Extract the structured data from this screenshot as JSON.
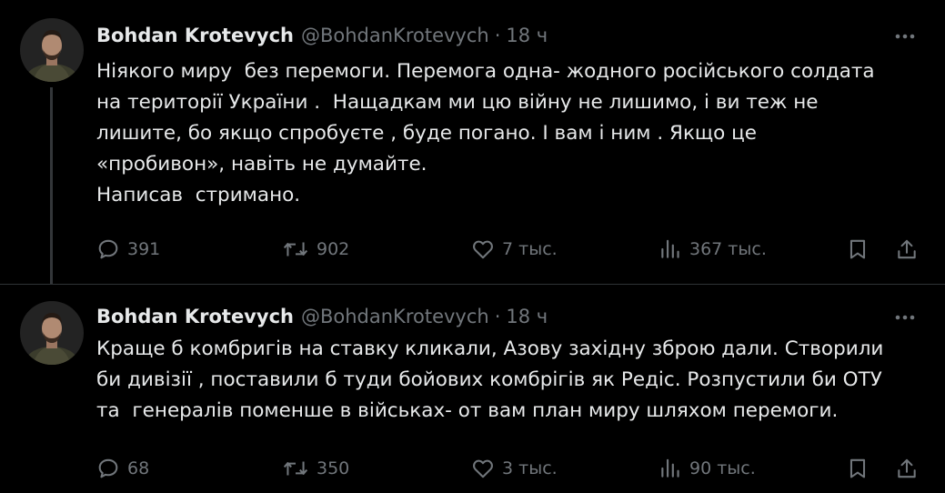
{
  "tweets": [
    {
      "author": {
        "name": "Bohdan Krotevych",
        "handle": "@BohdanKrotevych",
        "separator": "·",
        "time": "18 ч"
      },
      "lines": [
        "Ніякого миру  без перемоги. Перемога одна- жодного російського солдата",
        "на території України .  Нащадкам ми цю війну не лишимо, і ви теж не",
        "лишите, бо якщо спробуєте , буде погано. І вам і ним . Якщо це",
        "«пробивон», навіть не думайте.",
        "Написав  стримано."
      ],
      "stats": {
        "replies": "391",
        "reposts": "902",
        "likes": "7 тыс.",
        "views": "367 тыс."
      }
    },
    {
      "author": {
        "name": "Bohdan Krotevych",
        "handle": "@BohdanKrotevych",
        "separator": "·",
        "time": "18 ч"
      },
      "lines": [
        "Краще б комбригів на ставку кликали, Азову західну зброю дали. Створили",
        "би дивізії , поставили б туди бойових комбрігів як Редіс. Розпустили би ОТУ",
        "та  генералів поменше в військах- от вам план миру шляхом перемоги."
      ],
      "stats": {
        "replies": "68",
        "reposts": "350",
        "likes": "3 тыс.",
        "views": "90 тыс."
      }
    }
  ],
  "icons": {
    "reply": "reply-icon",
    "repost": "repost-icon",
    "like": "heart-icon",
    "views": "views-icon",
    "bookmark": "bookmark-icon",
    "share": "share-icon",
    "more": "more-icon"
  },
  "colors": {
    "background": "#000000",
    "text": "#e7e9ea",
    "secondary": "#71767b",
    "divider": "#2f3336"
  }
}
